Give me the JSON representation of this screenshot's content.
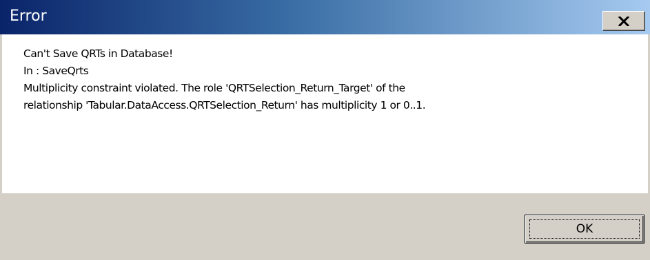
{
  "window": {
    "title": "Error",
    "close_icon": "close-icon"
  },
  "message": {
    "lines": [
      "Can't Save QRTs in Database!",
      "In : SaveQrts",
      "Multiplicity constraint violated. The role 'QRTSelection_Return_Target' of the",
      "relationship 'Tabular.DataAccess.QRTSelection_Return' has multiplicity 1 or 0..1."
    ]
  },
  "buttons": {
    "ok_label": "OK"
  },
  "colors": {
    "titlebar_start": "#0a246a",
    "titlebar_end": "#a6caf0",
    "dialog_face": "#d4d0c8",
    "content_background": "#ffffff"
  }
}
